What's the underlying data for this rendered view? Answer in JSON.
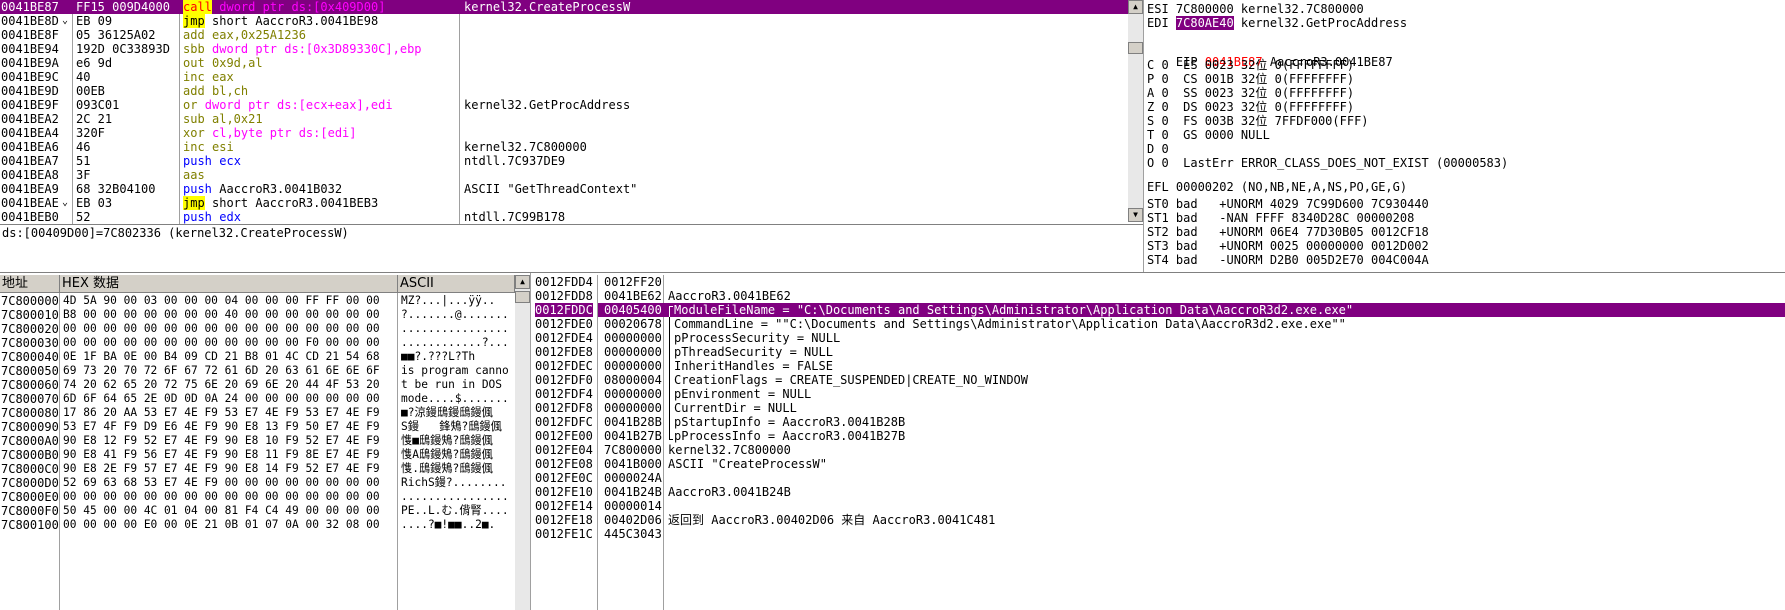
{
  "disasm": {
    "rows": [
      {
        "addr": "0041BE87",
        "mark": "",
        "bytes": "FF15 009D4000",
        "mnem": "call",
        "cls": "cmd-call",
        "ops": "dword ptr ds:[0x409D00]",
        "ops_cls": "kw-red",
        "comment": "kernel32.CreateProcessW",
        "selected": true
      },
      {
        "addr": "0041BE8D",
        "mark": "⌄",
        "bytes": "EB 09",
        "mnem": "jmp",
        "cls": "cmd-jmp",
        "ops": "short AaccroR3.0041BE98",
        "ops_cls": "kw-black",
        "comment": "",
        "selected": false
      },
      {
        "addr": "0041BE8F",
        "mark": "",
        "bytes": "05 36125A02",
        "mnem": "add",
        "cls": "kw-olive",
        "ops": "eax,0x25A1236",
        "ops_cls": "kw-olive",
        "comment": "",
        "selected": false
      },
      {
        "addr": "0041BE94",
        "mark": "",
        "bytes": "192D 0C33893D",
        "mnem": "sbb",
        "cls": "kw-olive",
        "ops": "dword ptr ds:[0x3D89330C],ebp",
        "ops_cls": "kw-pink",
        "comment": "",
        "selected": false
      },
      {
        "addr": "0041BE9A",
        "mark": "",
        "bytes": "e6 9d",
        "mnem": "out",
        "cls": "kw-olive",
        "ops": "0x9d,al",
        "ops_cls": "kw-olive",
        "comment": "",
        "selected": false
      },
      {
        "addr": "0041BE9C",
        "mark": "",
        "bytes": "40",
        "mnem": "inc",
        "cls": "kw-olive",
        "ops": "eax",
        "ops_cls": "kw-olive",
        "comment": "",
        "selected": false
      },
      {
        "addr": "0041BE9D",
        "mark": "",
        "bytes": "00EB",
        "mnem": "add",
        "cls": "kw-olive",
        "ops": "bl,ch",
        "ops_cls": "kw-olive",
        "comment": "",
        "selected": false
      },
      {
        "addr": "0041BE9F",
        "mark": "",
        "bytes": "093C01",
        "mnem": "or",
        "cls": "kw-olive",
        "ops": "dword ptr ds:[ecx+eax],edi",
        "ops_cls": "kw-pink",
        "comment": "kernel32.GetProcAddress",
        "selected": false
      },
      {
        "addr": "0041BEA2",
        "mark": "",
        "bytes": "2C 21",
        "mnem": "sub",
        "cls": "kw-olive",
        "ops": "al,0x21",
        "ops_cls": "kw-olive",
        "comment": "",
        "selected": false
      },
      {
        "addr": "0041BEA4",
        "mark": "",
        "bytes": "320F",
        "mnem": "xor",
        "cls": "kw-olive",
        "ops": "cl,byte ptr ds:[edi]",
        "ops_cls": "kw-pink",
        "comment": "",
        "selected": false
      },
      {
        "addr": "0041BEA6",
        "mark": "",
        "bytes": "46",
        "mnem": "inc",
        "cls": "kw-olive",
        "ops": "esi",
        "ops_cls": "kw-olive",
        "comment": "kernel32.7C800000",
        "selected": false
      },
      {
        "addr": "0041BEA7",
        "mark": "",
        "bytes": "51",
        "mnem": "push",
        "cls": "kw-blue",
        "ops": "ecx",
        "ops_cls": "kw-blue",
        "comment": "ntdll.7C937DE9",
        "selected": false
      },
      {
        "addr": "0041BEA8",
        "mark": "",
        "bytes": "3F",
        "mnem": "aas",
        "cls": "kw-olive",
        "ops": "",
        "ops_cls": "kw-olive",
        "comment": "",
        "selected": false
      },
      {
        "addr": "0041BEA9",
        "mark": "",
        "bytes": "68 32B04100",
        "mnem": "push",
        "cls": "kw-blue",
        "ops": "AaccroR3.0041B032",
        "ops_cls": "kw-black",
        "comment": "ASCII \"GetThreadContext\"",
        "selected": false
      },
      {
        "addr": "0041BEAE",
        "mark": "⌄",
        "bytes": "EB 03",
        "mnem": "jmp",
        "cls": "cmd-jmp",
        "ops": "short AaccroR3.0041BEB3",
        "ops_cls": "kw-black",
        "comment": "",
        "selected": false
      },
      {
        "addr": "0041BEB0",
        "mark": "",
        "bytes": "52",
        "mnem": "push",
        "cls": "kw-blue",
        "ops": "edx",
        "ops_cls": "kw-blue",
        "comment": "ntdll.7C99B178",
        "selected": false
      }
    ],
    "info": "ds:[00409D00]=7C802336 (kernel32.CreateProcessW)"
  },
  "registers": {
    "top": [
      {
        "name": "ESI",
        "value": "7C800000",
        "comment": "kernel32.7C800000",
        "style": ""
      },
      {
        "name": "EDI",
        "value": "7C80AE40",
        "comment": "kernel32.GetProcAddress",
        "style": "hl"
      }
    ],
    "eip": {
      "name": "EIP",
      "value": "0041BE87",
      "comment": "AaccroR3.0041BE87"
    },
    "flags": [
      {
        "f": "C",
        "v": "0",
        "seg": "ES",
        "sv": "0023",
        "bits": "32位",
        "desc": "0(FFFFFFFF)"
      },
      {
        "f": "P",
        "v": "0",
        "seg": "CS",
        "sv": "001B",
        "bits": "32位",
        "desc": "0(FFFFFFFF)"
      },
      {
        "f": "A",
        "v": "0",
        "seg": "SS",
        "sv": "0023",
        "bits": "32位",
        "desc": "0(FFFFFFFF)"
      },
      {
        "f": "Z",
        "v": "0",
        "seg": "DS",
        "sv": "0023",
        "bits": "32位",
        "desc": "0(FFFFFFFF)"
      },
      {
        "f": "S",
        "v": "0",
        "seg": "FS",
        "sv": "003B",
        "bits": "32位",
        "desc": "7FFDF000(FFF)"
      },
      {
        "f": "T",
        "v": "0",
        "seg": "GS",
        "sv": "0000",
        "bits": "",
        "desc": "NULL"
      },
      {
        "f": "D",
        "v": "0",
        "seg": "",
        "sv": "",
        "bits": "",
        "desc": ""
      },
      {
        "f": "O",
        "v": "0",
        "seg": "",
        "sv": "",
        "bits": "",
        "desc": "LastErr ERROR_CLASS_DOES_NOT_EXIST (00000583)"
      }
    ],
    "efl": "EFL 00000202 (NO,NB,NE,A,NS,PO,GE,G)",
    "st": [
      "ST0 bad   +UNORM 4029 7C99D600 7C930440",
      "ST1 bad   -NAN FFFF 8340D28C 00000208",
      "ST2 bad   +UNORM 06E4 77D30B05 0012CF18",
      "ST3 bad   +UNORM 0025 00000000 0012D002",
      "ST4 bad   -UNORM D2B0 005D2E70 004C004A"
    ]
  },
  "dump": {
    "headers": {
      "addr": "地址",
      "hex": "HEX 数据",
      "ascii": "ASCII"
    },
    "rows": [
      {
        "addr": "7C800000",
        "hex": "4D 5A 90 00 03 00 00 00 04 00 00 00 FF FF 00 00",
        "ascii": "MZ?...|...ÿÿ.."
      },
      {
        "addr": "7C800010",
        "hex": "B8 00 00 00 00 00 00 00 40 00 00 00 00 00 00 00",
        "ascii": "?.......@......."
      },
      {
        "addr": "7C800020",
        "hex": "00 00 00 00 00 00 00 00 00 00 00 00 00 00 00 00",
        "ascii": "................"
      },
      {
        "addr": "7C800030",
        "hex": "00 00 00 00 00 00 00 00 00 00 00 00 F0 00 00 00",
        "ascii": "............?..."
      },
      {
        "addr": "7C800040",
        "hex": "0E 1F BA 0E 00 B4 09 CD 21 B8 01 4C CD 21 54 68",
        "ascii": "■■?.???L?Th"
      },
      {
        "addr": "7C800050",
        "hex": "69 73 20 70 72 6F 67 72 61 6D 20 63 61 6E 6E 6F",
        "ascii": "is program canno"
      },
      {
        "addr": "7C800060",
        "hex": "74 20 62 65 20 72 75 6E 20 69 6E 20 44 4F 53 20",
        "ascii": "t be run in DOS "
      },
      {
        "addr": "7C800070",
        "hex": "6D 6F 64 65 2E 0D 0D 0A 24 00 00 00 00 00 00 00",
        "ascii": "mode....$......."
      },
      {
        "addr": "7C800080",
        "hex": "17 86 20 AA 53 E7 4E F9 53 E7 4E F9 53 E7 4E F9",
        "ascii": "■?涼鏝鴟鏝鴟鏝偑"
      },
      {
        "addr": "7C800090",
        "hex": "53 E7 4F F9 D9 E6 4E F9 90 E8 13 F9 50 E7 4E F9",
        "ascii": "S鏝   鋒鴩?鴟鏝偑"
      },
      {
        "addr": "7C8000A0",
        "hex": "90 E8 12 F9 52 E7 4E F9 90 E8 10 F9 52 E7 4E F9",
        "ascii": "愯■鴟鏝鴩?鴟鏝偑"
      },
      {
        "addr": "7C8000B0",
        "hex": "90 E8 41 F9 56 E7 4E F9 90 E8 11 F9 8E E7 4E F9",
        "ascii": "愯A鴟鏝鴩?鴟鏝偑"
      },
      {
        "addr": "7C8000C0",
        "hex": "90 E8 2E F9 57 E7 4E F9 90 E8 14 F9 52 E7 4E F9",
        "ascii": "愯.鴟鏝鴩?鴟鏝偑"
      },
      {
        "addr": "7C8000D0",
        "hex": "52 69 63 68 53 E7 4E F9 00 00 00 00 00 00 00 00",
        "ascii": "RichS鏝?........"
      },
      {
        "addr": "7C8000E0",
        "hex": "00 00 00 00 00 00 00 00 00 00 00 00 00 00 00 00",
        "ascii": "................"
      },
      {
        "addr": "7C8000F0",
        "hex": "50 45 00 00 4C 01 04 00 81 F4 C4 49 00 00 00 00",
        "ascii": "PE..L.む.偝腎...."
      },
      {
        "addr": "7C800100",
        "hex": "00 00 00 00 E0 00 0E 21 0B 01 07 0A 00 32 08 00",
        "ascii": "....?■!■■..2■."
      }
    ]
  },
  "stack": {
    "rows": [
      {
        "addr": "0012FDD4",
        "value": "0012FF20",
        "comment": "",
        "selected": false,
        "bracket": ""
      },
      {
        "addr": "0012FDD8",
        "value": "0041BE62",
        "comment": "AaccroR3.0041BE62",
        "selected": false,
        "bracket": ""
      },
      {
        "addr": "0012FDDC",
        "value": "00405400",
        "comment": "ModuleFileName = \"C:\\Documents and Settings\\Administrator\\Application Data\\AaccroR3d2.exe.exe\"",
        "selected": true,
        "bracket": "top"
      },
      {
        "addr": "0012FDE0",
        "value": "00020678",
        "comment": "CommandLine = \"\"C:\\Documents and Settings\\Administrator\\Application Data\\AaccroR3d2.exe.exe\"\"",
        "selected": false,
        "bracket": "mid"
      },
      {
        "addr": "0012FDE4",
        "value": "00000000",
        "comment": "pProcessSecurity = NULL",
        "selected": false,
        "bracket": "mid"
      },
      {
        "addr": "0012FDE8",
        "value": "00000000",
        "comment": "pThreadSecurity = NULL",
        "selected": false,
        "bracket": "mid"
      },
      {
        "addr": "0012FDEC",
        "value": "00000000",
        "comment": "InheritHandles = FALSE",
        "selected": false,
        "bracket": "mid"
      },
      {
        "addr": "0012FDF0",
        "value": "08000004",
        "comment": "CreationFlags = CREATE_SUSPENDED|CREATE_NO_WINDOW",
        "selected": false,
        "bracket": "mid"
      },
      {
        "addr": "0012FDF4",
        "value": "00000000",
        "comment": "pEnvironment = NULL",
        "selected": false,
        "bracket": "mid"
      },
      {
        "addr": "0012FDF8",
        "value": "00000000",
        "comment": "CurrentDir = NULL",
        "selected": false,
        "bracket": "mid"
      },
      {
        "addr": "0012FDFC",
        "value": "0041B28B",
        "comment": "pStartupInfo = AaccroR3.0041B28B",
        "selected": false,
        "bracket": "mid"
      },
      {
        "addr": "0012FE00",
        "value": "0041B27B",
        "comment": "pProcessInfo = AaccroR3.0041B27B",
        "selected": false,
        "bracket": "bot"
      },
      {
        "addr": "0012FE04",
        "value": "7C800000",
        "comment": "kernel32.7C800000",
        "selected": false,
        "bracket": ""
      },
      {
        "addr": "0012FE08",
        "value": "0041B000",
        "comment": "ASCII \"CreateProcessW\"",
        "selected": false,
        "bracket": ""
      },
      {
        "addr": "0012FE0C",
        "value": "0000024A",
        "comment": "",
        "selected": false,
        "bracket": ""
      },
      {
        "addr": "0012FE10",
        "value": "0041B24B",
        "comment": "AaccroR3.0041B24B",
        "selected": false,
        "bracket": ""
      },
      {
        "addr": "0012FE14",
        "value": "00000014",
        "comment": "",
        "selected": false,
        "bracket": ""
      },
      {
        "addr": "0012FE18",
        "value": "00402D06",
        "comment": "返回到 AaccroR3.00402D06 来自 AaccroR3.0041C481",
        "selected": false,
        "bracket": ""
      },
      {
        "addr": "0012FE1C",
        "value": "445C3043",
        "comment": "",
        "selected": false,
        "bracket": ""
      }
    ]
  },
  "colors": {
    "selection": "#800080",
    "call_bg": "#ffff00",
    "red": "#ff0000",
    "pink": "#ff00ff",
    "olive": "#808000",
    "blue": "#0000ff"
  }
}
